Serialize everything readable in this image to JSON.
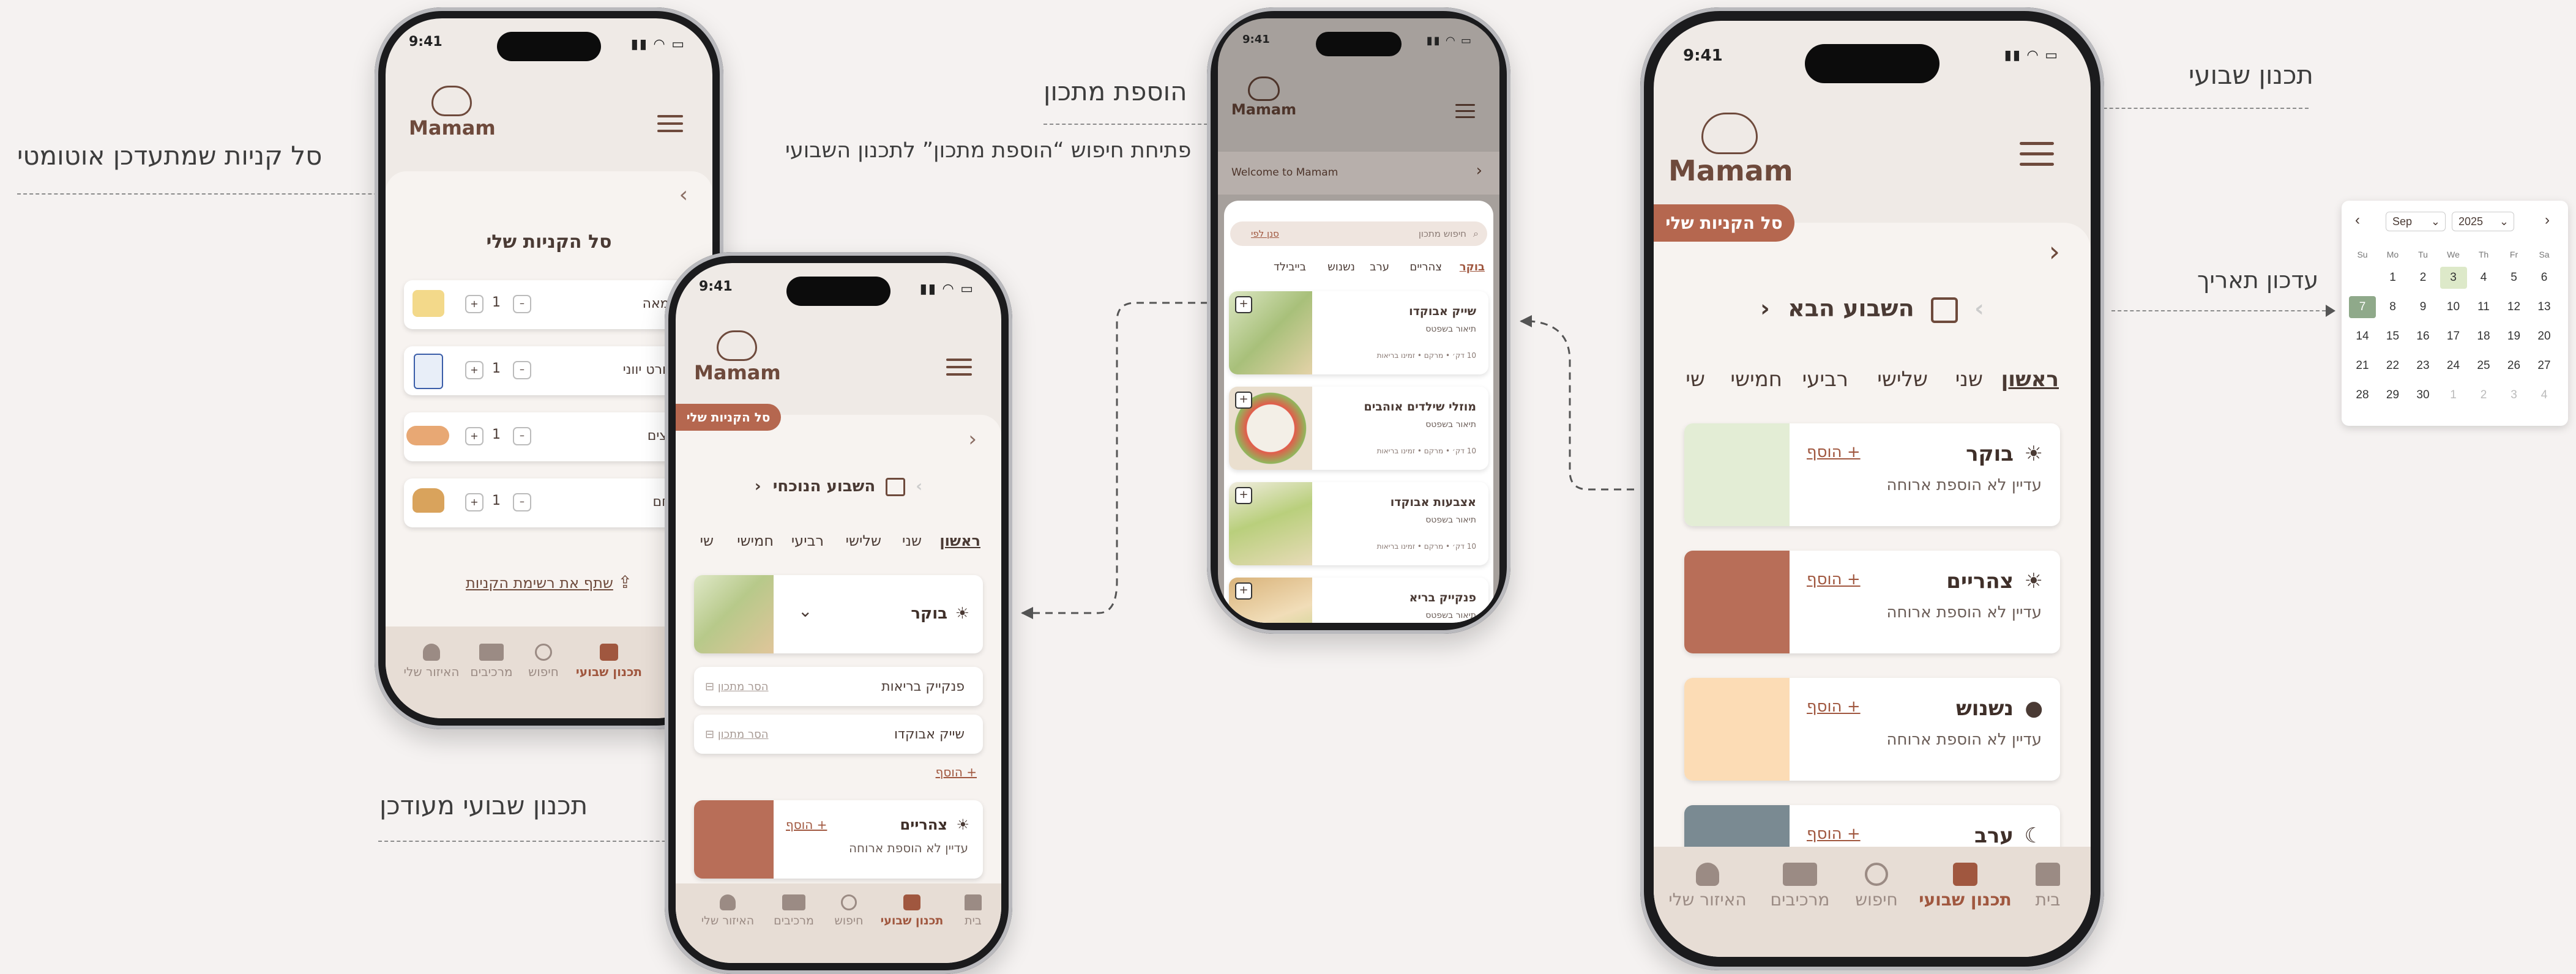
{
  "annotations": {
    "auto_cart": "סל קניות שמתעדכן אוטומטי",
    "add_recipe": "הוספת מתכון",
    "open_search": "פתיחת חיפוש “הוספת מתכון” לתכנון השבועי",
    "updated_plan": "תכנון שבועי מעודכן",
    "weekly_plan": "תכנון שבועי",
    "date_update": "עדכון תאריך"
  },
  "status_time": "9:41",
  "logo_text": "Mamam",
  "nav": {
    "home": "בית",
    "weekly_plan": "תכנון שבועי",
    "search": "חיפוש",
    "ingredients": "מרכיבים",
    "personal": "האיזור שלי"
  },
  "cart_phone": {
    "title": "סל הקניות שלי",
    "items": [
      {
        "name": "חמאה",
        "qty": "1"
      },
      {
        "name": "יוגורט יווני",
        "qty": "1"
      },
      {
        "name": "ביצים",
        "qty": "1"
      },
      {
        "name": "לחם",
        "qty": "1"
      }
    ],
    "share": "שתף את רשימת הקניות"
  },
  "current_phone": {
    "cart_button": "סל הקניות שלי",
    "week_title": "השבוע הנוכחי",
    "days": [
      "ראשון",
      "שני",
      "שלישי",
      "רביעי",
      "חמישי",
      "שי"
    ],
    "breakfast": "בוקר",
    "recipes": [
      {
        "name": "פנקייק בריאות",
        "remove": "הסר מתכון"
      },
      {
        "name": "שייק אבוקדו",
        "remove": "הסר מתכון"
      }
    ],
    "add_more": "+ הוסף",
    "lunch": "צהריים",
    "lunch_sub": "עדיין לא הוספת ארוחה",
    "lunch_add": "+ הוסף"
  },
  "search_phone": {
    "welcome": "Welcome to Mamam",
    "search_placeholder": "חיפוש מתכון",
    "filter": "סנן לפי",
    "meal_tabs": [
      "בוקר",
      "צהריים",
      "ערב",
      "נשנוש",
      "בייבילד"
    ],
    "recipes": [
      {
        "name": "שייק אבוקדו",
        "desc": "תיאור בשפטס",
        "meta": "10 דק׳ • מרקם • זמינו בריאות"
      },
      {
        "name": "מוזלי שילדים אוהבים",
        "desc": "תיאור בשפטס",
        "meta": "10 דק׳ • מרקם • זמינו בריאות"
      },
      {
        "name": "אצבעות אבוקדו",
        "desc": "תיאור בשפטס",
        "meta": "10 דק׳ • מרקם • זמינו בריאות"
      },
      {
        "name": "פנקייק בריא",
        "desc": "תיאור בשפטס",
        "meta": ""
      }
    ]
  },
  "next_phone": {
    "cart_button": "סל הקניות שלי",
    "week_title": "השבוע הבא",
    "days": [
      "ראשון",
      "שני",
      "שלישי",
      "רביעי",
      "חמישי",
      "שי"
    ],
    "meals": [
      {
        "name": "בוקר",
        "sub": "עדיין לא הוספת ארוחה",
        "add": "+ הוסף",
        "color": "#e3edd5"
      },
      {
        "name": "צהריים",
        "sub": "עדיין לא הוספת ארוחה",
        "add": "+ הוסף",
        "color": "#b86e58"
      },
      {
        "name": "נשנוש",
        "sub": "עדיין לא הוספת ארוחה",
        "add": "+ הוסף",
        "color": "#fcdcb5"
      },
      {
        "name": "ערב",
        "sub": "",
        "add": "+ הוסף",
        "color": "#7a8a92"
      }
    ]
  },
  "calendar": {
    "month": "Sep",
    "year": "2025",
    "weekdays": [
      "Su",
      "Mo",
      "Tu",
      "We",
      "Th",
      "Fr",
      "Sa"
    ],
    "rows": [
      [
        "",
        "1",
        "2",
        "3",
        "4",
        "5",
        "6"
      ],
      [
        "7",
        "8",
        "9",
        "10",
        "11",
        "12",
        "13"
      ],
      [
        "14",
        "15",
        "16",
        "17",
        "18",
        "19",
        "20"
      ],
      [
        "21",
        "22",
        "23",
        "24",
        "25",
        "26",
        "27"
      ],
      [
        "28",
        "29",
        "30",
        "1",
        "2",
        "3",
        "4"
      ]
    ],
    "today": "3",
    "selected": "7"
  },
  "colors": {
    "accent": "#a0573f",
    "cart_button": "#b5674f",
    "background": "#f5f2f1",
    "calendar_selected": "#8fa98a",
    "calendar_today": "#dde9c9"
  }
}
